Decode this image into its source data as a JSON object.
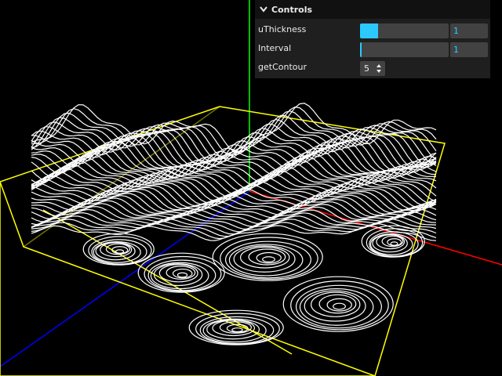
{
  "controls": {
    "title": "Controls",
    "uThickness": {
      "label": "uThickness",
      "value": "1",
      "fraction": 0.2
    },
    "interval": {
      "label": "Interval",
      "value": "1",
      "fraction": 0.0
    },
    "getContour": {
      "label": "getContour",
      "value": "5"
    }
  },
  "scene": {
    "background": "#000000",
    "box_color": "#ffff00",
    "contour_color": "#ffffff",
    "axis_colors": {
      "x": "#ff0000",
      "y": "#00ff00",
      "z": "#0000ff"
    }
  }
}
